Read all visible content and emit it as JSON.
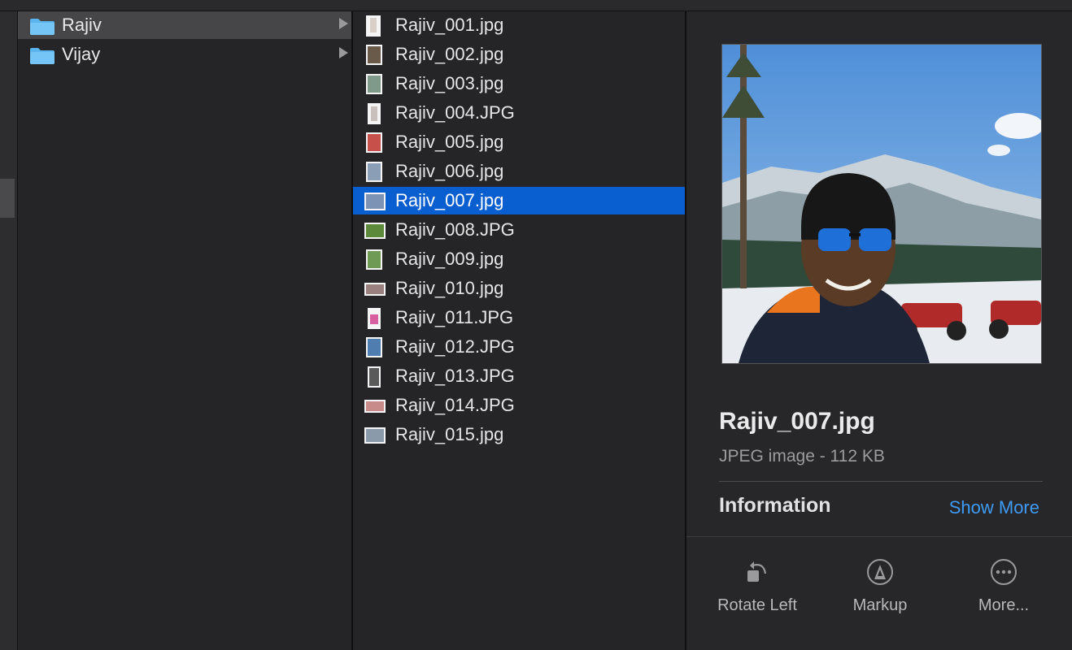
{
  "folders": [
    {
      "label": "Rajiv",
      "selected": true
    },
    {
      "label": "Vijay",
      "selected": false
    }
  ],
  "files": [
    {
      "label": "Rajiv_001.jpg"
    },
    {
      "label": "Rajiv_002.jpg"
    },
    {
      "label": "Rajiv_003.jpg"
    },
    {
      "label": "Rajiv_004.JPG"
    },
    {
      "label": "Rajiv_005.jpg"
    },
    {
      "label": "Rajiv_006.jpg"
    },
    {
      "label": "Rajiv_007.jpg",
      "selected": true
    },
    {
      "label": "Rajiv_008.JPG"
    },
    {
      "label": "Rajiv_009.jpg"
    },
    {
      "label": "Rajiv_010.jpg"
    },
    {
      "label": "Rajiv_011.JPG"
    },
    {
      "label": "Rajiv_012.JPG"
    },
    {
      "label": "Rajiv_013.JPG"
    },
    {
      "label": "Rajiv_014.JPG"
    },
    {
      "label": "Rajiv_015.jpg"
    }
  ],
  "preview": {
    "filename": "Rajiv_007.jpg",
    "kind": "JPEG image - 112 KB",
    "info_heading": "Information",
    "show_more": "Show More",
    "actions": [
      {
        "label": "Rotate Left",
        "icon": "rotate-left-icon"
      },
      {
        "label": "Markup",
        "icon": "markup-icon"
      },
      {
        "label": "More...",
        "icon": "more-icon"
      }
    ]
  },
  "colors": {
    "selection": "#0a5fd0",
    "folder_selection": "#464649",
    "link": "#3e9bf5",
    "folder": "#5bb4ee"
  }
}
